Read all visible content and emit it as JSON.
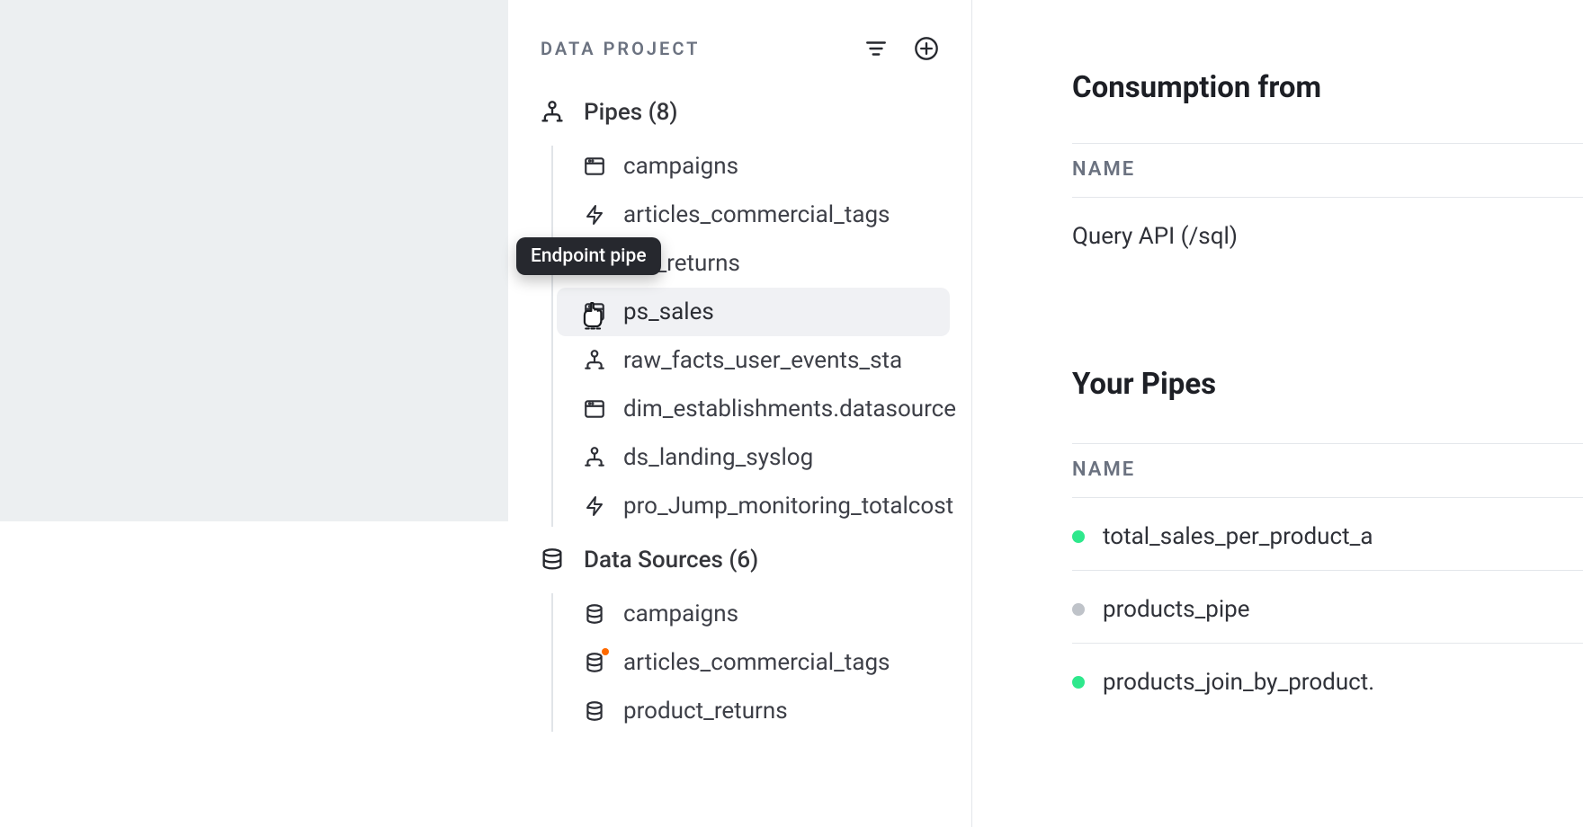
{
  "sidebar": {
    "title": "DATA PROJECT",
    "pipes_label": "Pipes (8)",
    "sources_label": "Data Sources (6)",
    "pipes": [
      {
        "label": "campaigns",
        "icon": "endpoint"
      },
      {
        "label": "articles_commercial_tags",
        "icon": "materialized"
      },
      {
        "label": "uct_returns",
        "icon": "endpoint"
      },
      {
        "label": "ps_sales",
        "icon": "endpoint",
        "hovered": true
      },
      {
        "label": "raw_facts_user_events_sta",
        "icon": "pipe"
      },
      {
        "label": "dim_establishments.datasource",
        "icon": "endpoint"
      },
      {
        "label": "ds_landing_syslog",
        "icon": "pipe"
      },
      {
        "label": "pro_Jump_monitoring_totalcost",
        "icon": "materialized"
      }
    ],
    "sources": [
      {
        "label": "campaigns"
      },
      {
        "label": "articles_commercial_tags",
        "badge": true
      },
      {
        "label": "product_returns"
      }
    ]
  },
  "tooltip": {
    "label": "Endpoint pipe"
  },
  "right": {
    "consumption_heading": "Consumption from",
    "name_label": "NAME",
    "consumption_name": "Query API (/sql)",
    "pipes_heading": "Your Pipes",
    "pipes": [
      {
        "label": "total_sales_per_product_a",
        "status": "green"
      },
      {
        "label": "products_pipe",
        "status": "gray"
      },
      {
        "label": "products_join_by_product.",
        "status": "green"
      }
    ]
  }
}
